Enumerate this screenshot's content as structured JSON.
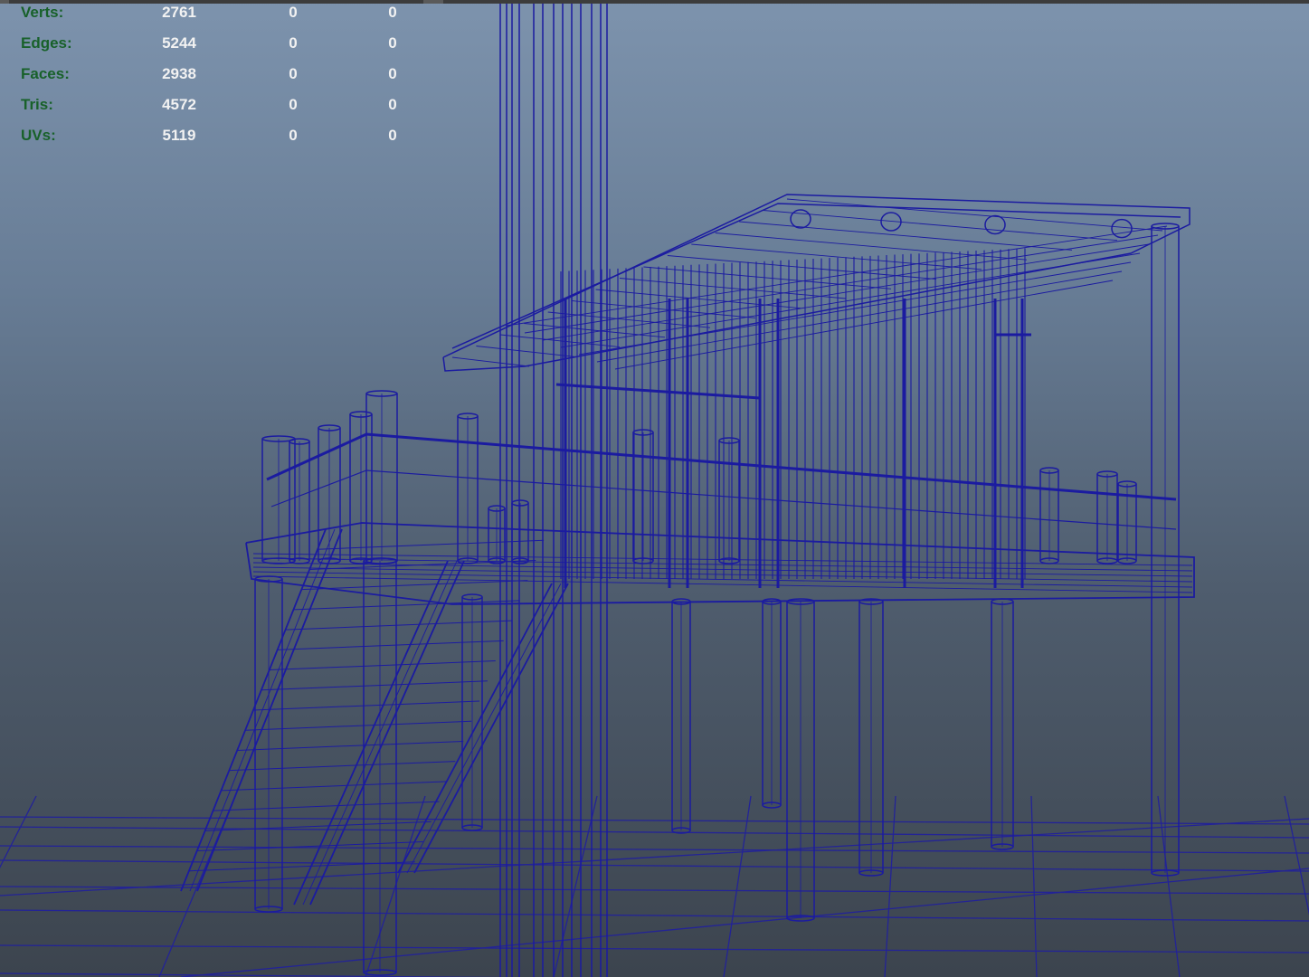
{
  "colors": {
    "wireframe": "#1b1ba0",
    "grid": "#232396",
    "hud_label": "#18612a",
    "hud_value": "#f2f2f2"
  },
  "hud": {
    "rows": [
      {
        "label": "Verts:",
        "values": [
          "2761",
          "0",
          "0"
        ]
      },
      {
        "label": "Edges:",
        "values": [
          "5244",
          "0",
          "0"
        ]
      },
      {
        "label": "Faces:",
        "values": [
          "2938",
          "0",
          "0"
        ]
      },
      {
        "label": "Tris:",
        "values": [
          "4572",
          "0",
          "0"
        ]
      },
      {
        "label": "UVs:",
        "values": [
          "5119",
          "0",
          "0"
        ]
      }
    ]
  }
}
